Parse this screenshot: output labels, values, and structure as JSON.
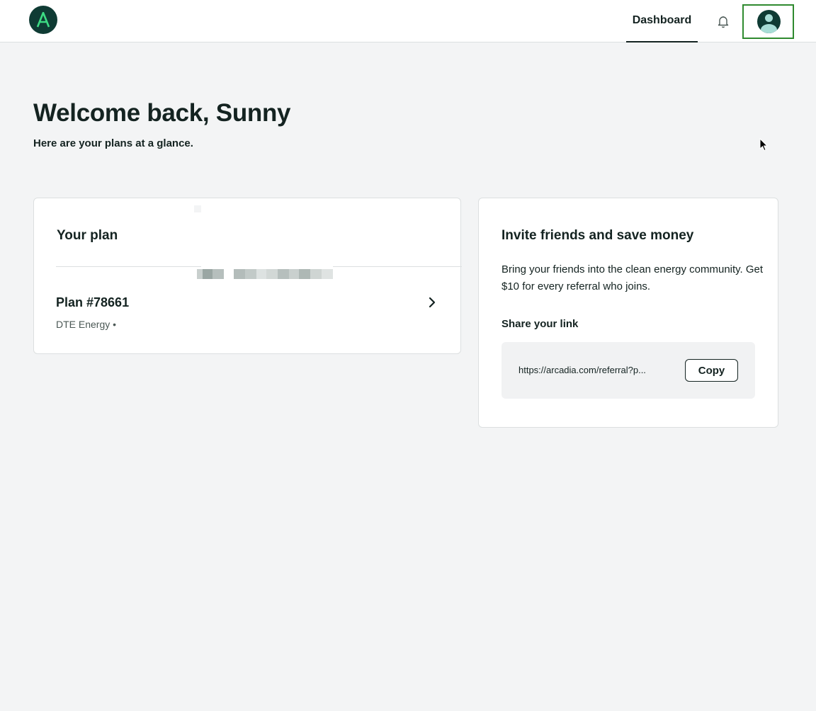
{
  "header": {
    "logo_letter": "A",
    "nav": {
      "dashboard_label": "Dashboard"
    },
    "icons": {
      "notifications": "bell-icon",
      "profile": "user-avatar-icon"
    }
  },
  "welcome": {
    "title": "Welcome back, Sunny",
    "subtitle": "Here are your plans at a glance."
  },
  "plan_card": {
    "title": "Your plan",
    "plan": {
      "name": "Plan #78661",
      "utility": "DTE Energy •"
    }
  },
  "invite_card": {
    "title": "Invite friends and save money",
    "description": "Bring your friends into the clean energy community. Get $10 for every referral who joins.",
    "share_label": "Share your link",
    "link": "https://arcadia.com/referral?p...",
    "copy_label": "Copy"
  },
  "colors": {
    "brand_dark": "#0f3b34",
    "brand_accent": "#3ddc84",
    "page_background": "#f3f4f5",
    "focus_outline": "#2f8a2f"
  }
}
